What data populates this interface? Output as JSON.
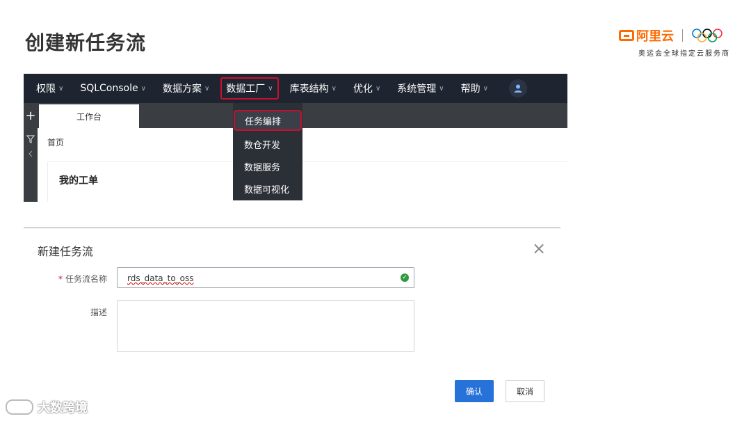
{
  "slide": {
    "title": "创建新任务流"
  },
  "brand": {
    "name": "阿里云",
    "subtitle": "奥运会全球指定云服务商"
  },
  "nav": {
    "items": [
      {
        "label": "权限",
        "chevron": "∨"
      },
      {
        "label": "SQLConsole",
        "chevron": "∨"
      },
      {
        "label": "数据方案",
        "chevron": "∨"
      },
      {
        "label": "数据工厂",
        "chevron": "∨"
      },
      {
        "label": "库表结构",
        "chevron": "∨"
      },
      {
        "label": "优化",
        "chevron": "∨"
      },
      {
        "label": "系统管理",
        "chevron": "∨"
      },
      {
        "label": "帮助",
        "chevron": "∨"
      }
    ],
    "active_index": 3
  },
  "tabs": {
    "plus": "+",
    "workbench": "工作台"
  },
  "workspace": {
    "breadcrumb": "首页",
    "card_title": "我的工单"
  },
  "dropdown": {
    "items": [
      "任务编排",
      "数仓开发",
      "数据服务",
      "数据可视化"
    ],
    "highlight_index": 0
  },
  "dialog": {
    "title": "新建任务流",
    "close": "×",
    "name_label": "任务流名称",
    "required_mark": "*",
    "name_value": "rds_data_to_oss",
    "desc_label": "描述",
    "desc_value": "",
    "confirm": "确认",
    "cancel": "取消"
  },
  "watermark": {
    "text": "大数跨境"
  },
  "colors": {
    "nav_bg": "#1f2530",
    "highlight_red": "#c8102e",
    "brand_orange": "#ff6a00",
    "primary_blue": "#2672d9"
  }
}
